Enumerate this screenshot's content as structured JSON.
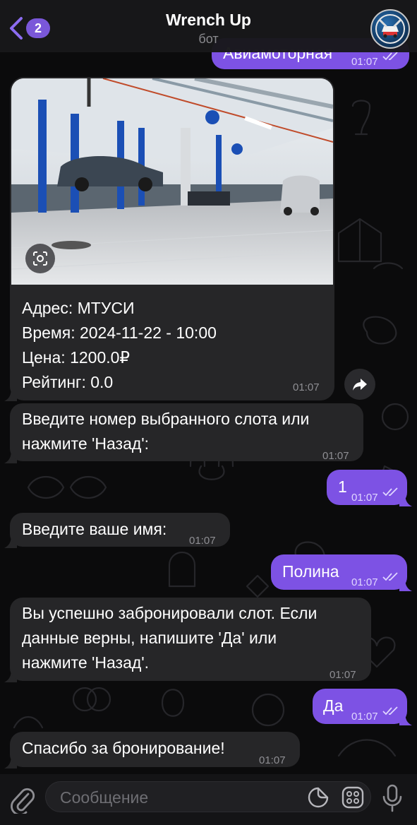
{
  "header": {
    "back_badge": "2",
    "title": "Wrench Up",
    "subtitle": "бот"
  },
  "messages": {
    "top_partial": {
      "text": "Авиамоторная",
      "time": "01:07"
    },
    "card": {
      "address": "Адрес: МТУСИ",
      "time_line": "Время: 2024-11-22 - 10:00",
      "price": "Цена: 1200.0₽",
      "rating": "Рейтинг: 0.0",
      "time": "01:07"
    },
    "slot_prompt": {
      "line1": "Введите номер выбранного слота или",
      "line2": "нажмите 'Назад':",
      "time": "01:07"
    },
    "reply_1": {
      "text": "1",
      "time": "01:07"
    },
    "name_prompt": {
      "text": "Введите ваше имя:",
      "time": "01:07"
    },
    "reply_name": {
      "text": "Полина",
      "time": "01:07"
    },
    "confirm": {
      "line1": "Вы успешно забронировали слот. Если",
      "line2": "данные верны, напишите 'Да' или",
      "line3": "нажмите 'Назад'.",
      "time": "01:07"
    },
    "reply_yes": {
      "text": "Да",
      "time": "01:07"
    },
    "thanks": {
      "text": "Спасибо за бронирование!",
      "time": "01:07"
    }
  },
  "input": {
    "placeholder": "Сообщение"
  },
  "colors": {
    "outgoing": "#7d52e4",
    "incoming": "#262628",
    "badge": "#7a57d9"
  },
  "icons": [
    "back-chevron-icon",
    "avatar-logo-icon",
    "scan-lens-icon",
    "share-arrow-icon",
    "paperclip-icon",
    "sticker-icon",
    "emoji-grid-icon",
    "microphone-icon",
    "double-check-icon"
  ]
}
